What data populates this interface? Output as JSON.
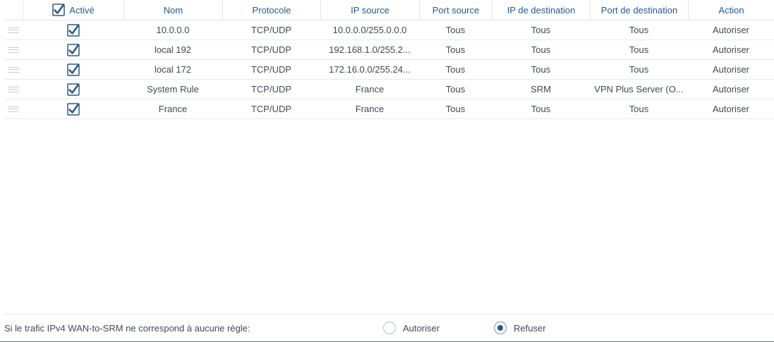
{
  "columns": {
    "active": "Activé",
    "name": "Nom",
    "protocol": "Protocole",
    "ip_source": "IP source",
    "port_source": "Port source",
    "ip_dest": "IP de destination",
    "port_dest": "Port de destination",
    "action": "Action"
  },
  "rules": [
    {
      "name": "10.0.0.0",
      "protocol": "TCP/UDP",
      "ip_source": "10.0.0.0/255.0.0.0",
      "port_source": "Tous",
      "ip_dest": "Tous",
      "port_dest": "Tous",
      "action": "Autoriser"
    },
    {
      "name": "local 192",
      "protocol": "TCP/UDP",
      "ip_source": "192.168.1.0/255.2...",
      "port_source": "Tous",
      "ip_dest": "Tous",
      "port_dest": "Tous",
      "action": "Autoriser"
    },
    {
      "name": "local 172",
      "protocol": "TCP/UDP",
      "ip_source": "172.16.0.0/255.24...",
      "port_source": "Tous",
      "ip_dest": "Tous",
      "port_dest": "Tous",
      "action": "Autoriser"
    },
    {
      "name": "System Rule",
      "protocol": "TCP/UDP",
      "ip_source": "France",
      "port_source": "Tous",
      "ip_dest": "SRM",
      "port_dest": "VPN Plus Server (O...",
      "action": "Autoriser"
    },
    {
      "name": "France",
      "protocol": "TCP/UDP",
      "ip_source": "France",
      "port_source": "Tous",
      "ip_dest": "Tous",
      "port_dest": "Tous",
      "action": "Autoriser"
    }
  ],
  "footer": {
    "label": "Si le trafic IPv4 WAN-to-SRM ne correspond à aucune règle:",
    "option_allow": "Autoriser",
    "option_deny": "Refuser",
    "selected": "deny"
  },
  "colors": {
    "accent": "#1f5b8f",
    "checkbox": "#2c5a8a"
  }
}
